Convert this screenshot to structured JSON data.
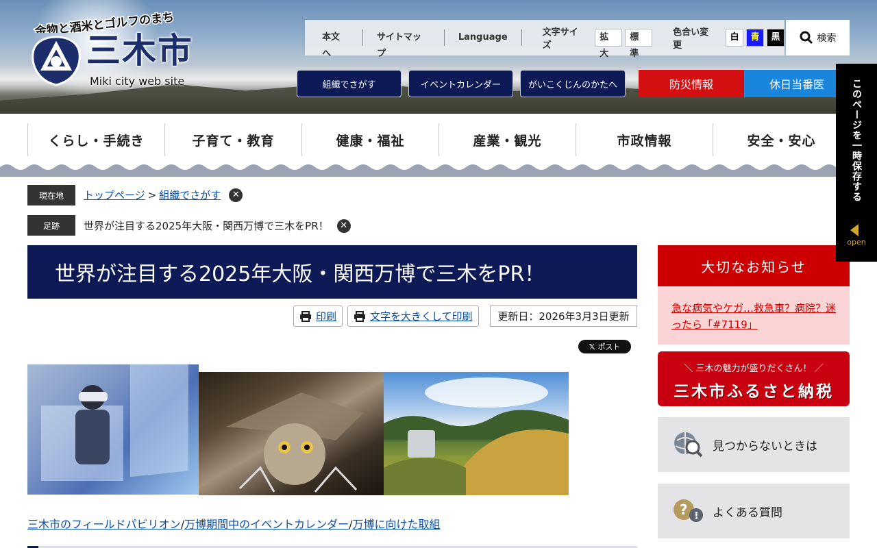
{
  "header": {
    "tagline": "金物と酒米とゴルフのまち",
    "site_name": "三木市",
    "site_sub": "Miki city web site"
  },
  "utility": {
    "skip_link": "本文へ",
    "sitemap": "サイトマップ",
    "language": "Language",
    "font_size_label": "文字サイズ",
    "font_size_large": "拡大",
    "font_size_normal": "標準",
    "color_label": "色合い変更",
    "color_white": "白",
    "color_blue": "青",
    "color_black": "黒",
    "search": "検索"
  },
  "quick_nav": {
    "org": "組織でさがす",
    "events": "イベントカレンダー",
    "foreigners": "がいこくじんのかたへ",
    "disaster": "防災情報",
    "holiday": "休日当番医"
  },
  "main_menu": [
    {
      "label": "くらし・手続き"
    },
    {
      "label": "子育て・教育"
    },
    {
      "label": "健康・福祉"
    },
    {
      "label": "産業・観光"
    },
    {
      "label": "市政情報"
    },
    {
      "label": "安全・安心"
    }
  ],
  "breadcrumb": {
    "current_label": "現在地",
    "home": "トップページ",
    "separator": ">",
    "current": "組織でさがす",
    "history_label": "足跡",
    "history_item": "世界が注目する2025年大阪・関西万博で三木をPR！"
  },
  "page": {
    "title": "世界が注目する2025年大阪・関西万博で三木をPR！",
    "print": "印刷",
    "print_large": "文字を大きくして印刷",
    "updated": "更新日：2026年3月3日更新",
    "x_post": "ポスト",
    "links": [
      "三木市のフィールドパビリオン",
      "万博期間中のイベントカレンダー",
      "万博に向けた取組"
    ],
    "link_sep": "/"
  },
  "sidebar": {
    "notice_title": "大切なお知らせ",
    "notice_link": "急な病気やケガ…救急車？病院？迷ったら「#7119」",
    "furusato_small": "＼ 三木の魅力が盛りだくさん！ ／",
    "furusato_large": "三木市ふるさと納税",
    "not_found": "見つからないときは",
    "faq": "よくある質問"
  },
  "save_tab": {
    "label": "このページを一時保存する",
    "open": "open"
  },
  "colors": {
    "navy": "#0d1a55",
    "red": "#d30f12",
    "blue": "#1a86db",
    "link": "#0a4fa8"
  }
}
